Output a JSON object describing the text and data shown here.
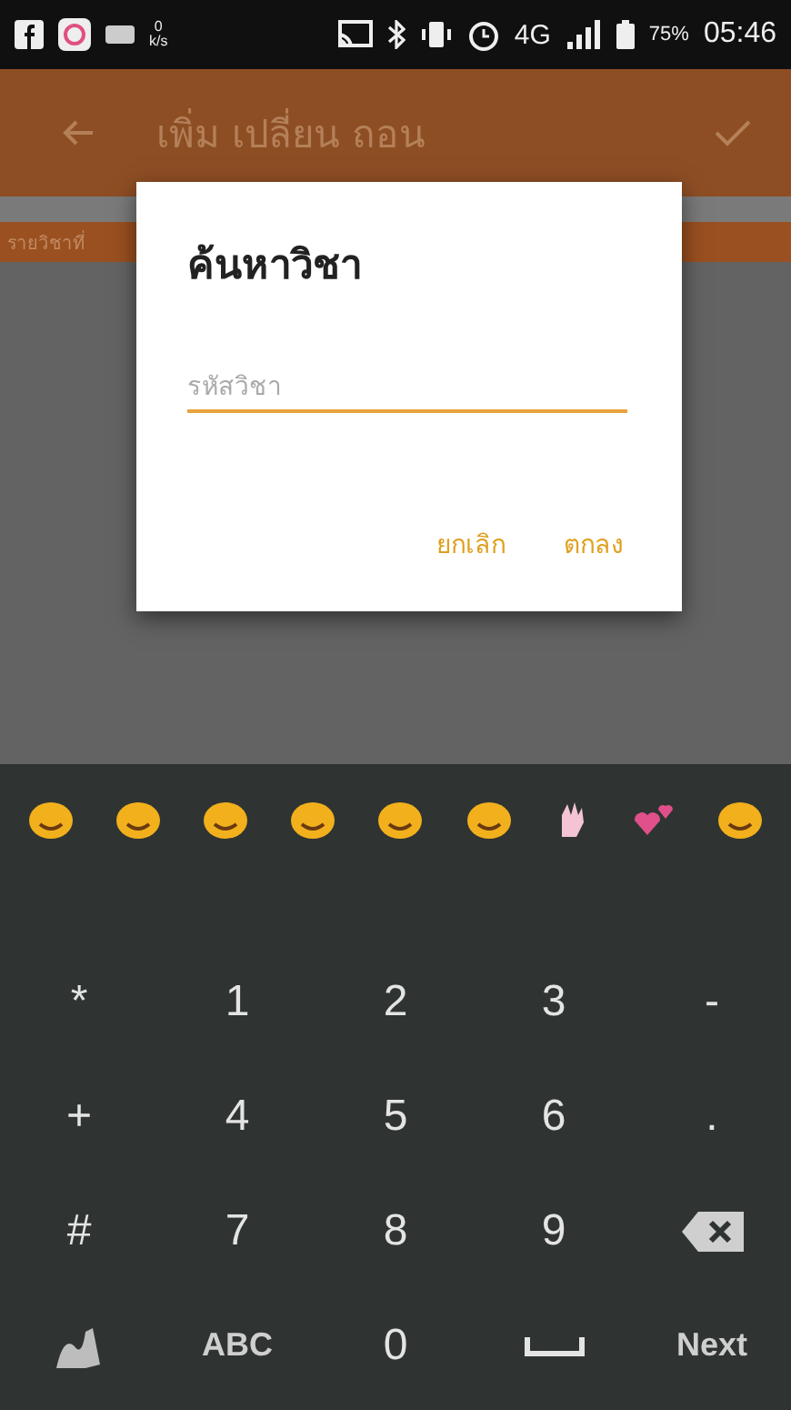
{
  "status_bar": {
    "net_speed": "0",
    "net_unit": "k/s",
    "network": "4G",
    "battery": "75%",
    "time": "05:46"
  },
  "app_bar": {
    "title": "เพิ่ม เปลี่ยน ถอน"
  },
  "section_header": {
    "label": "รายวิชาที่"
  },
  "dialog": {
    "title": "ค้นหาวิชา",
    "field": {
      "placeholder": "รหัสวิชา"
    },
    "buttons": [
      "ยกเลิก",
      "ตกลง"
    ]
  },
  "keyboard": {
    "suggestions": [
      {
        "kind": "face"
      },
      {
        "kind": "face"
      },
      {
        "kind": "face"
      },
      {
        "kind": "face"
      },
      {
        "kind": "face"
      },
      {
        "kind": "face"
      },
      {
        "kind": "hand"
      },
      {
        "kind": "hearts"
      },
      {
        "kind": "face"
      }
    ],
    "rows": [
      [
        {
          "kind": "text",
          "label": "*"
        },
        {
          "kind": "text",
          "label": "1"
        },
        {
          "kind": "text",
          "label": "2"
        },
        {
          "kind": "text",
          "label": "3"
        },
        {
          "kind": "text",
          "label": "-"
        }
      ],
      [
        {
          "kind": "text",
          "label": "+"
        },
        {
          "kind": "text",
          "label": "4"
        },
        {
          "kind": "text",
          "label": "5"
        },
        {
          "kind": "text",
          "label": "6"
        },
        {
          "kind": "text",
          "label": "."
        }
      ],
      [
        {
          "kind": "text",
          "label": "#"
        },
        {
          "kind": "text",
          "label": "7"
        },
        {
          "kind": "text",
          "label": "8"
        },
        {
          "kind": "text",
          "label": "9"
        },
        {
          "kind": "backspace"
        }
      ],
      [
        {
          "kind": "gesture"
        },
        {
          "kind": "text",
          "label": "ABC"
        },
        {
          "kind": "text",
          "label": "0"
        },
        {
          "kind": "space"
        },
        {
          "kind": "text",
          "label": "Next"
        }
      ]
    ]
  }
}
